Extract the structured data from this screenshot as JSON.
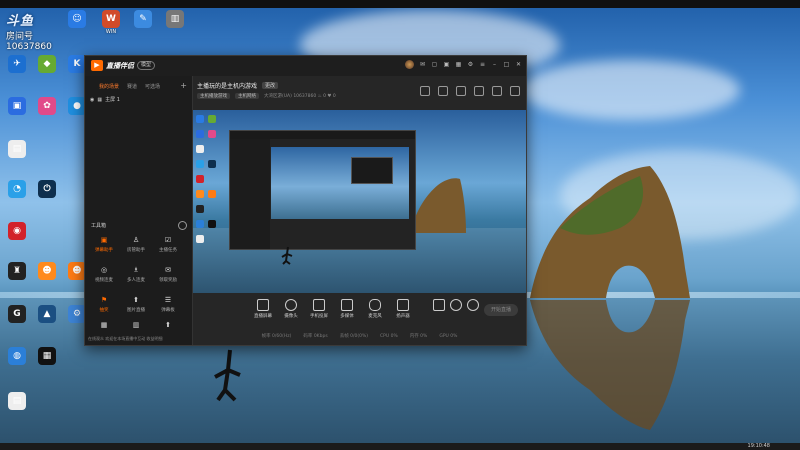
{
  "desktop": {
    "badge": {
      "logo_text": "斗鱼",
      "room_label": "房间号",
      "room_number": "10637860"
    },
    "icons": [
      {
        "id": "1",
        "label": "",
        "glyph": "☺",
        "color": "#2a7be4"
      },
      {
        "id": "2",
        "label": "WIN",
        "glyph": "W",
        "color": "#d14b2a"
      },
      {
        "id": "3",
        "label": "",
        "glyph": "✎",
        "color": "#3c8be0"
      },
      {
        "id": "4",
        "label": "",
        "glyph": "▥",
        "color": "#777"
      },
      {
        "id": "5",
        "label": "",
        "glyph": "✈",
        "color": "#1c6fd0"
      },
      {
        "id": "6",
        "label": "",
        "glyph": "◆",
        "color": "#6a3"
      },
      {
        "id": "7",
        "label": "",
        "glyph": "K",
        "color": "#2a7be4"
      },
      {
        "id": "8",
        "label": "",
        "glyph": "▣",
        "color": "#2b6ce0"
      },
      {
        "id": "9",
        "label": "",
        "glyph": "✿",
        "color": "#e14a8a"
      },
      {
        "id": "10",
        "label": "",
        "glyph": "●",
        "color": "#1f8fe0"
      },
      {
        "id": "11",
        "label": "",
        "glyph": "▤",
        "color": "#eee"
      },
      {
        "id": "12",
        "label": "",
        "glyph": "◔",
        "color": "#2aa0e8"
      },
      {
        "id": "13",
        "label": "",
        "glyph": "⏻",
        "color": "#0e2f4e"
      },
      {
        "id": "14",
        "label": "",
        "glyph": "◉",
        "color": "#d2222a"
      },
      {
        "id": "15",
        "label": "",
        "glyph": "♜",
        "color": "#222"
      },
      {
        "id": "16",
        "label": "",
        "glyph": "☻",
        "color": "#ff8a1c"
      },
      {
        "id": "17",
        "label": "",
        "glyph": "☻",
        "color": "#ff7b14"
      },
      {
        "id": "18",
        "label": "",
        "glyph": "G",
        "color": "#222"
      },
      {
        "id": "19",
        "label": "",
        "glyph": "▲",
        "color": "#1b4f82"
      },
      {
        "id": "20",
        "label": "",
        "glyph": "⚙",
        "color": "#3d84d6"
      },
      {
        "id": "21",
        "label": "",
        "glyph": "◍",
        "color": "#2b7fd8"
      },
      {
        "id": "22",
        "label": "",
        "glyph": "▦",
        "color": "#111"
      },
      {
        "id": "23",
        "label": "",
        "glyph": "▤",
        "color": "#eee"
      }
    ],
    "taskbar_time": "19:10:48"
  },
  "app": {
    "name": "直播伴侣",
    "version": "模型",
    "sidebar": {
      "tabs": [
        "我的场景",
        "赛道",
        "可选场"
      ],
      "scene_label": "主屏 1",
      "tools_heading": "工具箱",
      "tools": [
        {
          "label": "弹幕助手",
          "glyph": "▣",
          "hot": true
        },
        {
          "label": "房管助手",
          "glyph": "♙",
          "hot": false
        },
        {
          "label": "主播任务",
          "glyph": "☑",
          "hot": false
        },
        {
          "label": "视频连麦",
          "glyph": "◎",
          "hot": false
        },
        {
          "label": "多人连麦",
          "glyph": "♗",
          "hot": false
        },
        {
          "label": "领取奖励",
          "glyph": "✉",
          "hot": false
        },
        {
          "label": "抽奖",
          "glyph": "⚑",
          "hot": true
        },
        {
          "label": "图片直播",
          "glyph": "⬆",
          "hot": false
        },
        {
          "label": "弹幕板",
          "glyph": "☰",
          "hot": false
        },
        {
          "label": "",
          "glyph": "▦",
          "hot": false
        },
        {
          "label": "",
          "glyph": "▥",
          "hot": false
        },
        {
          "label": "",
          "glyph": "⬆",
          "hot": false
        }
      ],
      "bottom_text": "在线观众  欢迎在本场直播中互动  收益明细"
    },
    "stream": {
      "title": "主播玩的是主机内游戏",
      "title_tag": "更改",
      "sub_pill1": "主机播放游戏",
      "sub_pill2": "主机网络",
      "sub_text": "大湾区游(UA)  10637860  ♨ 0  ♥ 0"
    },
    "actions": [
      {
        "label": "直播屏幕"
      },
      {
        "label": "摄像头"
      },
      {
        "label": "手机投屏"
      },
      {
        "label": "多媒体"
      },
      {
        "label": "麦克风"
      },
      {
        "label": "扬声器"
      }
    ],
    "go_live": "开始直播",
    "status": [
      "帧率 0/60(Hz)",
      "码率 0Kbps",
      "丢帧 0/0(0%)",
      "CPU 0%",
      "内存 0%",
      "GPU 0%"
    ]
  }
}
